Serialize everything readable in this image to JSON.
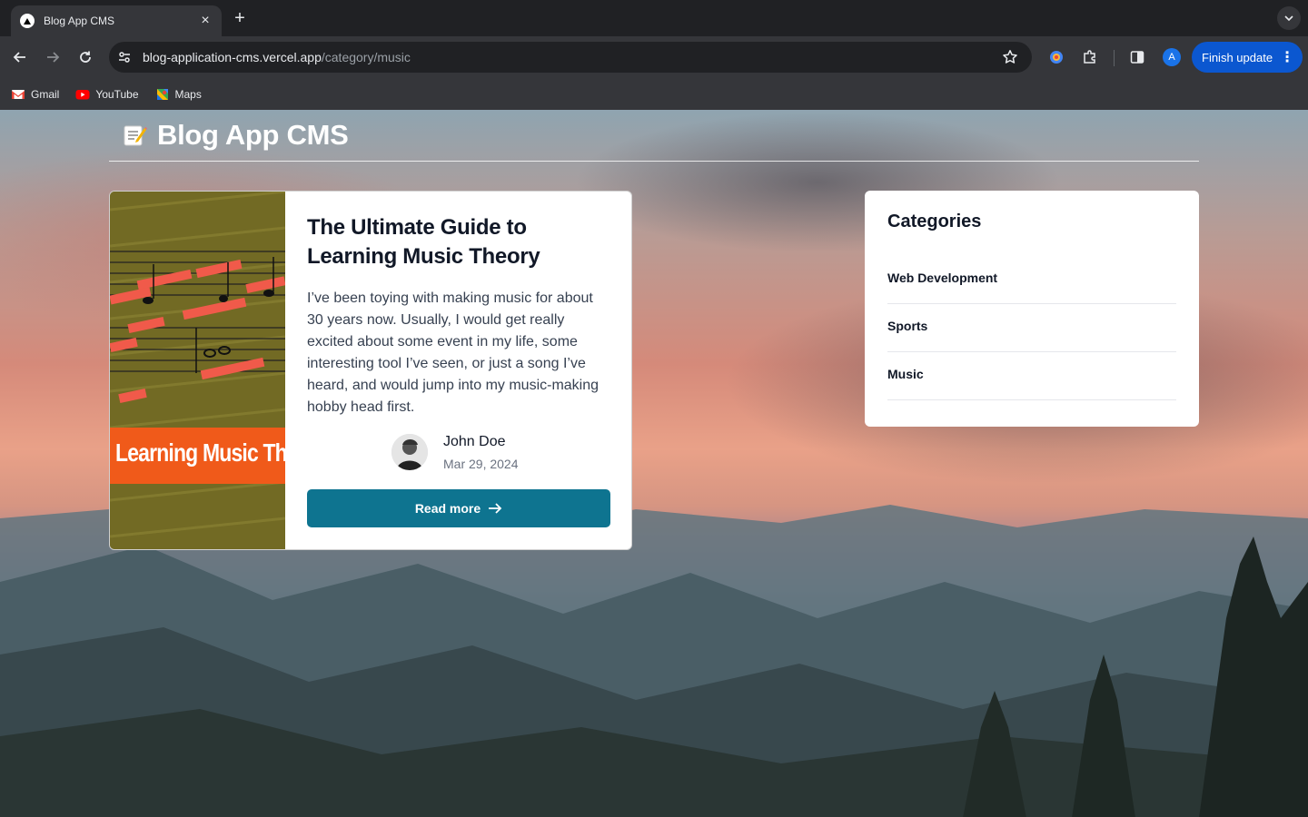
{
  "browser": {
    "tab_title": "Blog App CMS",
    "url_host": "blog-application-cms.vercel.app",
    "url_path": "/category/music",
    "profile_initial": "A",
    "finish_update_label": "Finish update",
    "bookmarks": [
      {
        "label": "Gmail",
        "icon": "gmail-icon"
      },
      {
        "label": "YouTube",
        "icon": "youtube-icon"
      },
      {
        "label": "Maps",
        "icon": "maps-icon"
      }
    ]
  },
  "site": {
    "title": "Blog App CMS",
    "logo_icon": "memo-icon"
  },
  "post": {
    "title": "The Ultimate Guide to Learning Music Theory",
    "excerpt": "I’ve been toying with making music for about 30 years now. Usually, I would get really excited about some event in my life, some interesting tool I’ve seen, or just a song I’ve heard, and would jump into my music-making hobby head first.",
    "image_banner_text": "Learning Music Theory",
    "author_name": "John Doe",
    "date": "Mar 29, 2024",
    "read_more_label": "Read more"
  },
  "sidebar": {
    "title": "Categories",
    "categories": [
      "Web Development",
      "Sports",
      "Music"
    ]
  },
  "colors": {
    "button": "#0e7490",
    "banner": "#f05a1a",
    "chrome_accent": "#0b57d0"
  }
}
